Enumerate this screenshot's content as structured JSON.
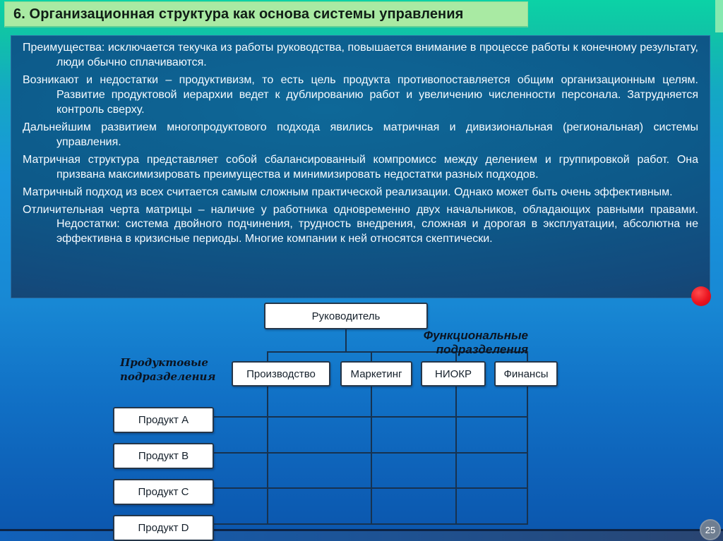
{
  "slide": {
    "title": "6. Организационная структура как основа системы управления",
    "page_number": "25"
  },
  "textbox": {
    "paragraphs": [
      "Преимущества: исключается текучка из работы руководства, повышается внимание в процессе работы к конечному результату, люди обычно сплачиваются.",
      "Возникают и недостатки – продуктивизм, то есть цель продукта противопоставляется общим организационным целям. Развитие продуктовой иерархии ведет к дублированию работ и увеличению численности персонала. Затрудняется контроль сверху.",
      "Дальнейшим развитием многопродуктового подхода явились матричная и дивизиональная (региональная) системы управления.",
      "Матричная структура представляет собой сбалансированный компромисс между делением и группировкой работ. Она призвана максимизировать преимущества и минимизировать недостатки разных подходов.",
      "Матричный подход из всех считается самым сложным практической реализации. Однако может быть очень эффективным.",
      "Отличительная черта матрицы – наличие у работника одновременно двух начальников, обладающих равными правами. Недостатки: система двойного подчинения, трудность внедрения, сложная и дорогая в эксплуатации, абсолютна не эффективна в кризисные периоды. Многие компании к ней относятся скептически."
    ]
  },
  "diagram": {
    "root": "Руководитель",
    "functional_label": "Функциональные подразделения",
    "product_label": "Продуктовые подразделения",
    "functions": [
      "Производство",
      "Маркетинг",
      "НИОКР",
      "Финансы"
    ],
    "products": [
      "Продукт A",
      "Продукт B",
      "Продукт C",
      "Продукт D"
    ]
  },
  "colors": {
    "title_bar_bg": "#a9eaa3",
    "background_top_teal": "#0bd2a6",
    "background_bottom_blue": "#0b55ac",
    "text_panel_bg": "#0d5a8a",
    "panel_text": "#f6fbff",
    "diagram_line": "#17324f",
    "accent_red": "#ea1420",
    "footer_band": "#1161ba",
    "page_badge": "#6f7e91"
  }
}
